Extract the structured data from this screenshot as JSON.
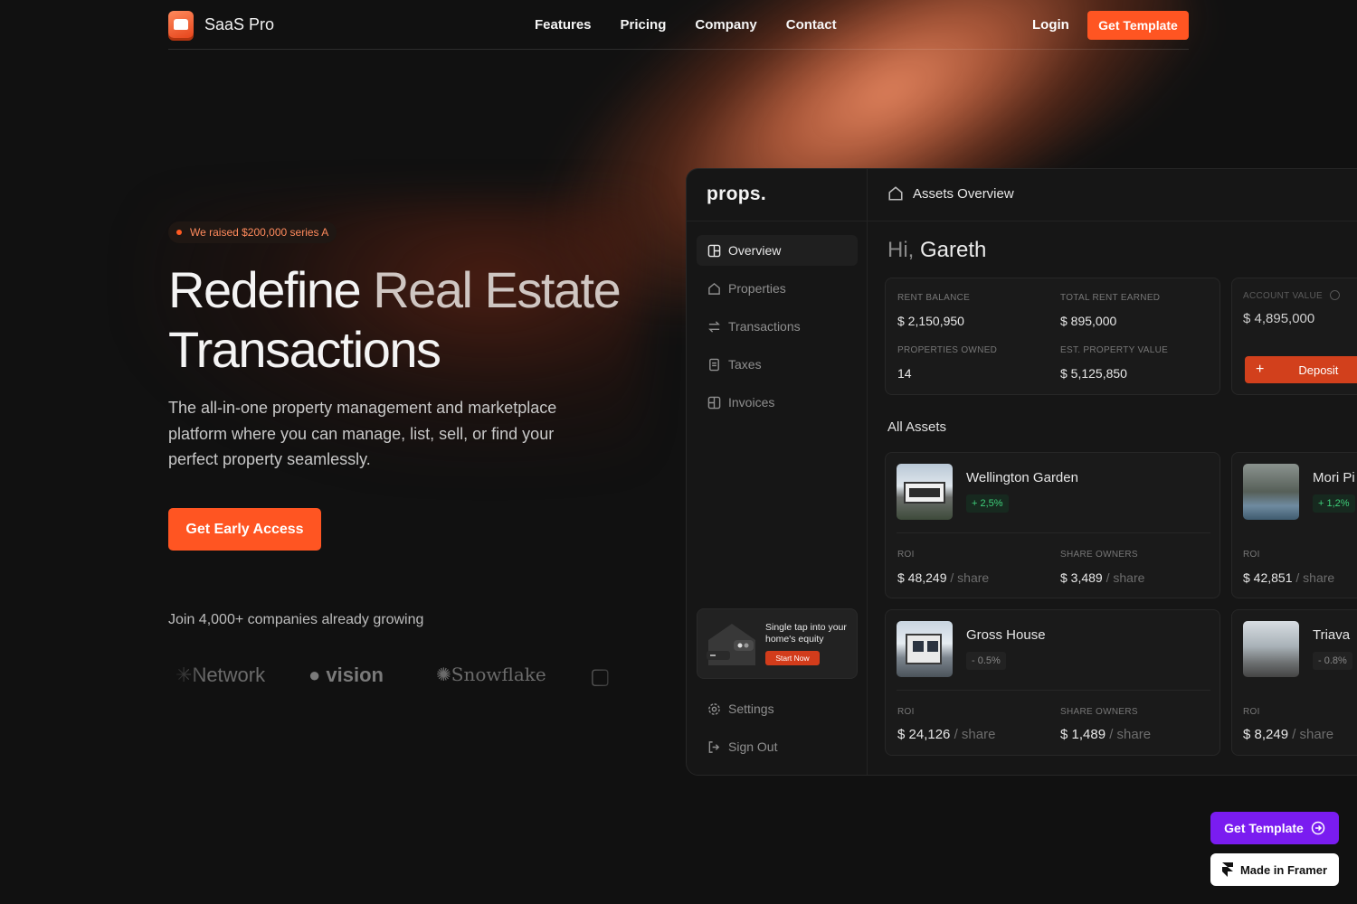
{
  "nav": {
    "brand": "SaaS Pro",
    "links": [
      "Features",
      "Pricing",
      "Company",
      "Contact"
    ],
    "login": "Login",
    "cta": "Get Template"
  },
  "hero": {
    "badge": "We raised $200,000 series A",
    "title_line1_a": "Redefine ",
    "title_line1_b": "Real Estate",
    "title_line2": "Transactions",
    "subtitle": "The all-in-one property management and marketplace platform where you can manage, list, sell, or find your perfect property seamlessly.",
    "cta": "Get Early Access",
    "join": "Join 4,000+ companies already growing",
    "logos": [
      "Network",
      "vision",
      "Snowflake"
    ]
  },
  "dashboard": {
    "logo": "props.",
    "header": "Assets Overview",
    "greeting_hi": "Hi,",
    "greeting_name": "Gareth",
    "nav": [
      "Overview",
      "Properties",
      "Transactions",
      "Taxes",
      "Invoices"
    ],
    "bottom_nav": [
      "Settings",
      "Sign Out"
    ],
    "promo": {
      "text": "Single tap into your home's equity",
      "button": "Start Now"
    },
    "stats": {
      "rent_balance_label": "RENT BALANCE",
      "rent_balance": "$ 2,150,950",
      "total_rent_label": "TOTAL RENT EARNED",
      "total_rent": "$ 895,000",
      "props_owned_label": "PROPERTIES OWNED",
      "props_owned": "14",
      "est_value_label": "EST. PROPERTY VALUE",
      "est_value": "$ 5,125,850",
      "account_value_label": "ACCOUNT VALUE",
      "account_value": "$ 4,895,000",
      "deposit": "Deposit"
    },
    "section": "All Assets",
    "assets": [
      {
        "name": "Wellington Garden",
        "change": "+ 2,5%",
        "roi_label": "ROI",
        "roi": "$ 48,249",
        "owners_label": "SHARE OWNERS",
        "owners": "$ 3,489",
        "unit": "/ share"
      },
      {
        "name": "Mori Pi",
        "change": "+ 1,2%",
        "roi_label": "ROI",
        "roi": "$ 42,851",
        "unit": "/ share"
      },
      {
        "name": "Gross House",
        "change": "- 0.5%",
        "roi_label": "ROI",
        "roi": "$ 24,126",
        "owners_label": "SHARE OWNERS",
        "owners": "$ 1,489",
        "unit": "/ share"
      },
      {
        "name": "Triava",
        "change": "- 0.8%",
        "roi_label": "ROI",
        "roi": "$ 8,249",
        "unit": "/ share"
      }
    ]
  },
  "floating": {
    "template": "Get Template",
    "framer": "Made in Framer"
  },
  "colors": {
    "accent": "#ff5522",
    "purple": "#7a1cf0",
    "bg": "#111111"
  }
}
